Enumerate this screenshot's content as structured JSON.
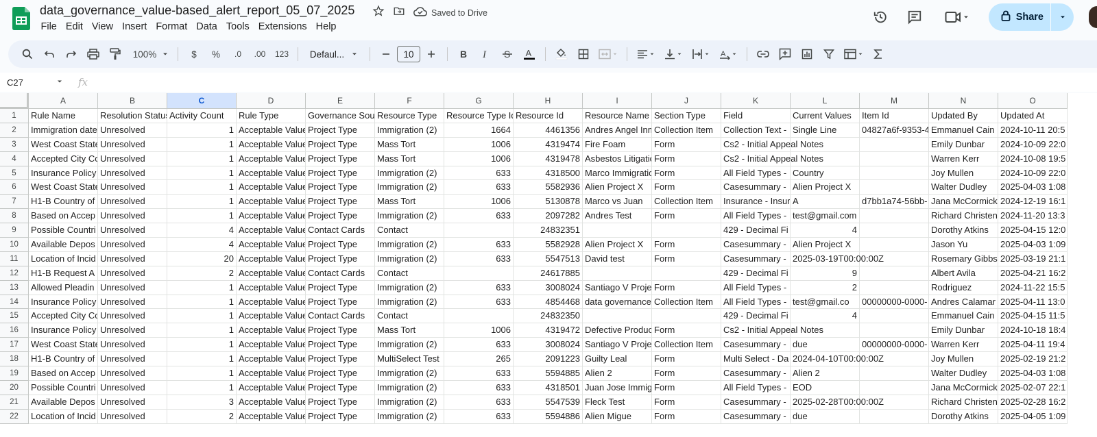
{
  "doc": {
    "title": "data_governance_value-based_alert_report_05_07_2025",
    "saved_status": "Saved to Drive",
    "share_label": "Share"
  },
  "menu": [
    "File",
    "Edit",
    "View",
    "Insert",
    "Format",
    "Data",
    "Tools",
    "Extensions",
    "Help"
  ],
  "toolbar": {
    "zoom": "100%",
    "currency": "$",
    "percent": "%",
    "dec_decrease": ".0",
    "dec_increase": ".00",
    "number_format": "123",
    "font": "Defaul...",
    "font_size": "10"
  },
  "formula_bar": {
    "name_box": "C27",
    "fx": "fx",
    "content": ""
  },
  "grid": {
    "selected_column": "C",
    "columns": [
      "A",
      "B",
      "C",
      "D",
      "E",
      "F",
      "G",
      "H",
      "I",
      "J",
      "K",
      "L",
      "M",
      "N",
      "O"
    ],
    "header": [
      "Rule Name",
      "Resolution Status",
      "Activity Count",
      "Rule Type",
      "Governance Source",
      "Resource Type",
      "Resource Type Id",
      "Resource Id",
      "Resource Name",
      "Section Type",
      "Field",
      "Current Values",
      "Item Id",
      "Updated By",
      "Updated At"
    ],
    "rows": [
      [
        "Immigration date",
        "Unresolved",
        "1",
        "Acceptable Value",
        "Project Type",
        "Immigration (2)",
        "1664",
        "4461356",
        "Andres Angel Inm",
        "Collection Item",
        "Collection Text -",
        "Single Line",
        "04827a6f-9353-4",
        "Emmanuel Cain",
        "2024-10-11 20:5"
      ],
      [
        "West Coast State",
        "Unresolved",
        "1",
        "Acceptable Value",
        "Project Type",
        "Mass Tort",
        "1006",
        "4319474",
        "Fire Foam",
        "Form",
        "Cs2 - Initial Appeal Notes",
        "",
        "",
        "Emily Dunbar",
        "2024-10-09 22:0"
      ],
      [
        "Accepted City Co",
        "Unresolved",
        "1",
        "Acceptable Value",
        "Project Type",
        "Mass Tort",
        "1006",
        "4319478",
        "Asbestos Litigatio",
        "Form",
        "Cs2 - Initial Appeal Notes",
        "",
        "",
        "Warren Kerr",
        "2024-10-08 19:5"
      ],
      [
        "Insurance Policy",
        "Unresolved",
        "1",
        "Acceptable Value",
        "Project Type",
        "Immigration (2)",
        "633",
        "4318500",
        "Marco Immigratio",
        "Form",
        "All Field Types -",
        "Country",
        "",
        "Joy Mullen",
        "2024-10-09 22:0"
      ],
      [
        "West Coast State",
        "Unresolved",
        "1",
        "Acceptable Value",
        "Project Type",
        "Immigration (2)",
        "633",
        "5582936",
        "Alien Project X",
        "Form",
        "Casesummary -",
        "Alien Project X",
        "",
        "Walter Dudley",
        "2025-04-03 1:08"
      ],
      [
        "H1-B Country of",
        "Unresolved",
        "1",
        "Acceptable Value",
        "Project Type",
        "Mass Tort",
        "1006",
        "5130878",
        "Marco vs Juan",
        "Collection Item",
        "Insurance - Insur",
        "A",
        "d7bb1a74-56bb-",
        "Jana McCormick",
        "2024-12-19 16:1"
      ],
      [
        "Based on Accep",
        "Unresolved",
        "1",
        "Acceptable Value",
        "Project Type",
        "Immigration (2)",
        "633",
        "2097282",
        "Andres Test",
        "Form",
        "All Field Types -",
        "test@gmail.com",
        "",
        "Richard Christen",
        "2024-11-20 13:3"
      ],
      [
        "Possible Countri",
        "Unresolved",
        "4",
        "Acceptable Value",
        "Contact Cards",
        "Contact",
        "",
        "24832351",
        "",
        "",
        "429 - Decimal Fi",
        "4",
        "",
        "Dorothy Atkins",
        "2025-04-15 12:0"
      ],
      [
        "Available Depos",
        "Unresolved",
        "4",
        "Acceptable Value",
        "Project Type",
        "Immigration (2)",
        "633",
        "5582928",
        "Alien Project X",
        "Form",
        "Casesummary -",
        "Alien Project X",
        "",
        "Jason Yu",
        "2025-04-03 1:09"
      ],
      [
        "Location of Incid",
        "Unresolved",
        "20",
        "Acceptable Value",
        "Project Type",
        "Immigration (2)",
        "633",
        "5547513",
        "David test",
        "Form",
        "Casesummary -",
        "2025-03-19T00:00:00Z",
        "",
        "Rosemary Gibbs",
        "2025-03-19 21:1"
      ],
      [
        "H1-B Request A",
        "Unresolved",
        "2",
        "Acceptable Value",
        "Contact Cards",
        "Contact",
        "",
        "24617885",
        "",
        "",
        "429 - Decimal Fi",
        "9",
        "",
        "Albert Avila",
        "2025-04-21 16:2"
      ],
      [
        "Allowed Pleadin",
        "Unresolved",
        "1",
        "Acceptable Value",
        "Project Type",
        "Immigration (2)",
        "633",
        "3008024",
        "Santiago V Proje",
        "Form",
        "All Field Types -",
        "2",
        "",
        "Rodriguez",
        "2024-11-22 15:5"
      ],
      [
        "Insurance Policy",
        "Unresolved",
        "1",
        "Acceptable Value",
        "Project Type",
        "Immigration (2)",
        "633",
        "4854468",
        "data governance",
        "Collection Item",
        "All Field Types -",
        "test@gmail.co",
        "00000000-0000-",
        "Andres Calamar",
        "2025-04-11 13:0"
      ],
      [
        "Accepted City Co",
        "Unresolved",
        "1",
        "Acceptable Value",
        "Contact Cards",
        "Contact",
        "",
        "24832350",
        "",
        "",
        "429 - Decimal Fi",
        "4",
        "",
        "Emmanuel Cain",
        "2025-04-15 11:5"
      ],
      [
        "Insurance Policy",
        "Unresolved",
        "1",
        "Acceptable Value",
        "Project Type",
        "Mass Tort",
        "1006",
        "4319472",
        "Defective Produc",
        "Form",
        "Cs2 - Initial Appeal Notes",
        "",
        "",
        "Emily Dunbar",
        "2024-10-18 18:4"
      ],
      [
        "West Coast State",
        "Unresolved",
        "1",
        "Acceptable Value",
        "Project Type",
        "Immigration (2)",
        "633",
        "3008024",
        "Santiago V Proje",
        "Collection Item",
        "Casesummary -",
        "due",
        "00000000-0000-",
        "Warren Kerr",
        "2025-04-11 19:4"
      ],
      [
        "H1-B Country of",
        "Unresolved",
        "1",
        "Acceptable Value",
        "Project Type",
        "MultiSelect Test",
        "265",
        "2091223",
        "Guilty Leal",
        "Form",
        "Multi Select - Da",
        "2024-04-10T00:00:00Z",
        "",
        "Joy Mullen",
        "2025-02-19 21:2"
      ],
      [
        "Based on Accep",
        "Unresolved",
        "1",
        "Acceptable Value",
        "Project Type",
        "Immigration (2)",
        "633",
        "5594885",
        "Alien 2",
        "Form",
        "Casesummary -",
        "Alien 2",
        "",
        "Walter Dudley",
        "2025-04-03 1:08"
      ],
      [
        "Possible Countri",
        "Unresolved",
        "1",
        "Acceptable Value",
        "Project Type",
        "Immigration (2)",
        "633",
        "4318501",
        "Juan Jose Immig",
        "Form",
        "All Field Types -",
        "EOD",
        "",
        "Jana McCormick",
        "2025-02-07 22:1"
      ],
      [
        "Available Depos",
        "Unresolved",
        "3",
        "Acceptable Value",
        "Project Type",
        "Immigration (2)",
        "633",
        "5547539",
        "Fleck Test",
        "Form",
        "Casesummary -",
        "2025-02-28T00:00:00Z",
        "",
        "Richard Christen",
        "2025-02-28 16:2"
      ],
      [
        "Location of Incid",
        "Unresolved",
        "2",
        "Acceptable Value",
        "Project Type",
        "Immigration (2)",
        "633",
        "5594886",
        "Alien Migue",
        "Form",
        "Casesummary -",
        "due",
        "",
        "Dorothy Atkins",
        "2025-04-05 1:09"
      ]
    ]
  }
}
